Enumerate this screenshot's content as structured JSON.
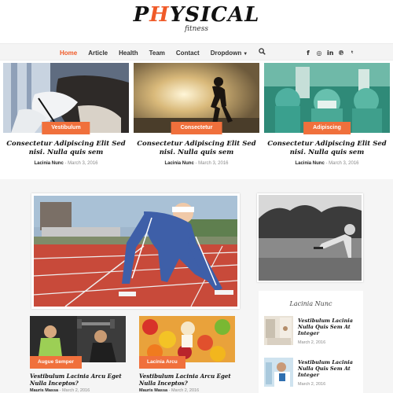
{
  "logo": {
    "prefix": "P",
    "accent": "H",
    "rest": "YSICAL",
    "sub": "fitness"
  },
  "nav": {
    "items": [
      {
        "label": "Home",
        "active": true
      },
      {
        "label": "Article"
      },
      {
        "label": "Health"
      },
      {
        "label": "Team"
      },
      {
        "label": "Contact"
      },
      {
        "label": "Dropdown"
      }
    ],
    "search_icon": "search-icon",
    "social": [
      {
        "icon": "facebook-icon",
        "glyph": "f"
      },
      {
        "icon": "instagram-icon",
        "glyph": "◎"
      },
      {
        "icon": "linkedin-icon",
        "glyph": "in"
      },
      {
        "icon": "pinterest-icon",
        "glyph": "℗"
      },
      {
        "icon": "twitter-icon",
        "glyph": "ᵗ"
      }
    ]
  },
  "featured": [
    {
      "badge": "Vestibulum",
      "title": "Consectetur Adipiscing Elit Sed nisi. Nulla quis sem",
      "author": "Lacinia Nunc",
      "date": "March 3, 2016"
    },
    {
      "badge": "Consectetur",
      "title": "Consectetur Adipiscing Elit Sed nisi. Nulla quis sem",
      "author": "Lacinia Nunc",
      "date": "March 3, 2016"
    },
    {
      "badge": "Adipiscing",
      "title": "Consectetur Adipiscing Elit Sed nisi. Nulla quis sem",
      "author": "Lacinia Nunc",
      "date": "March 3, 2016"
    }
  ],
  "sidebar": {
    "heading": "Lacinia Nunc",
    "items": [
      {
        "title": "Vestibulum Lacinia Nulla Quis Sem At Integer",
        "date": "March 2, 2016"
      },
      {
        "title": "Vestibulum Lacinia Nulla Quis Sem At Integer",
        "date": "March 2, 2016"
      }
    ]
  },
  "small_posts": [
    {
      "badge": "Augue Semper",
      "title": "Vestibulum Lacinia Arcu Eget Nulla Inceptos?",
      "author": "Mauris Massa",
      "date": "March 2, 2016"
    },
    {
      "badge": "Lacinia Arcu",
      "title": "Vestibulum Lacinia Arcu Eget Nulla Inceptos?",
      "author": "Mauris Massa",
      "date": "March 2, 2016"
    }
  ],
  "colors": {
    "accent": "#f05a28",
    "badge": "#f0703c"
  }
}
